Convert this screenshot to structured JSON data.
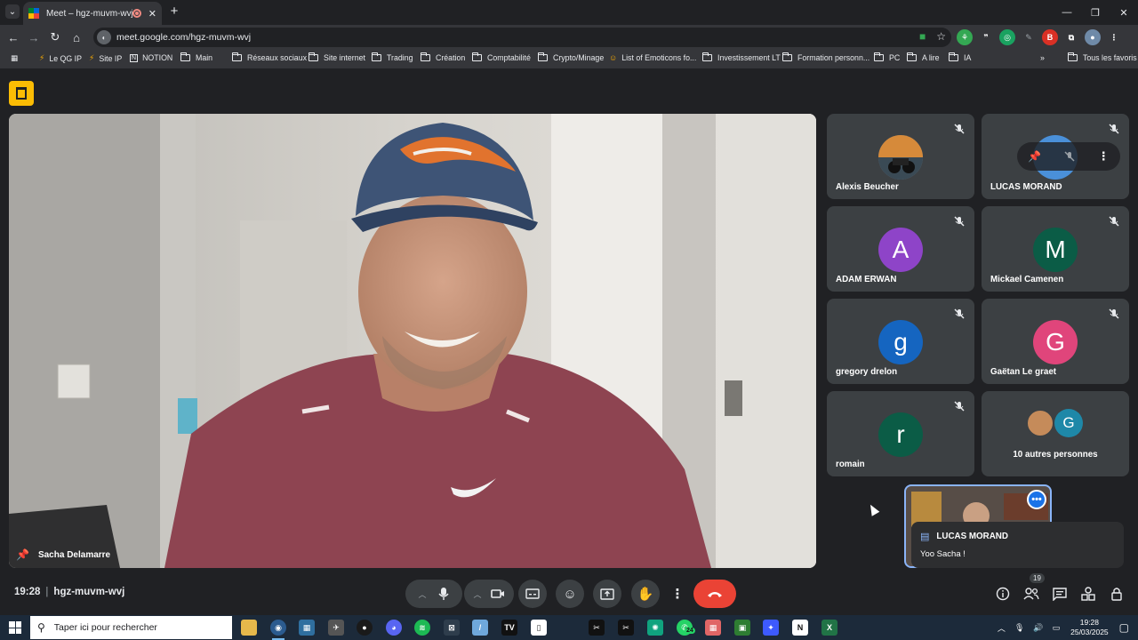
{
  "browser": {
    "tab": {
      "title": "Meet – hgz-muvm-wvj"
    },
    "url": "meet.google.com/hgz-muvm-wvj",
    "bookmarks": [
      {
        "label": "Le QG IP",
        "icon": "lightning-icon",
        "type": "link"
      },
      {
        "label": "Site IP",
        "icon": "lightning-icon",
        "type": "link"
      },
      {
        "label": "NOTION",
        "icon": "notion-icon",
        "type": "link"
      },
      {
        "label": "Main",
        "icon": "folder-icon",
        "type": "folder"
      },
      {
        "label": "Réseaux sociaux",
        "icon": "folder-icon",
        "type": "folder"
      },
      {
        "label": "Site internet",
        "icon": "folder-icon",
        "type": "folder"
      },
      {
        "label": "Trading",
        "icon": "folder-icon",
        "type": "folder"
      },
      {
        "label": "Création",
        "icon": "folder-icon",
        "type": "folder"
      },
      {
        "label": "Comptabilité",
        "icon": "folder-icon",
        "type": "folder"
      },
      {
        "label": "Crypto/Minage",
        "icon": "folder-icon",
        "type": "folder"
      },
      {
        "label": "List of Emoticons fo...",
        "icon": "emoji-icon",
        "type": "link"
      },
      {
        "label": "Investissement LT",
        "icon": "folder-icon",
        "type": "folder"
      },
      {
        "label": "Formation personn...",
        "icon": "folder-icon",
        "type": "folder"
      },
      {
        "label": "PC",
        "icon": "folder-icon",
        "type": "folder"
      },
      {
        "label": "A lire",
        "icon": "folder-icon",
        "type": "folder"
      },
      {
        "label": "IA",
        "icon": "folder-icon",
        "type": "folder"
      }
    ],
    "all_bookmarks": "Tous les favoris"
  },
  "meet": {
    "speaker_name": "Sacha Delamarre",
    "participants": [
      {
        "name": "Alexis Beucher",
        "initial": "",
        "color": "",
        "muted": true
      },
      {
        "name": "LUCAS MORAND",
        "initial": "",
        "color": "#4a90d9",
        "muted": true
      },
      {
        "name": "ADAM ERWAN",
        "initial": "A",
        "color": "#8e44c8",
        "muted": true
      },
      {
        "name": "Mickael Camenen",
        "initial": "M",
        "color": "#0b5c46",
        "muted": true
      },
      {
        "name": "gregory drelon",
        "initial": "g",
        "color": "#1565c0",
        "muted": true
      },
      {
        "name": "Gaëtan Le graet",
        "initial": "G",
        "color": "#e0457b",
        "muted": true
      },
      {
        "name": "romain",
        "initial": "r",
        "color": "#0b5c46",
        "muted": true
      }
    ],
    "others": {
      "label": "10 autres personnes",
      "initial": "G",
      "color": "#1e88a8"
    },
    "chat": {
      "sender": "LUCAS MORAND",
      "message": "Yoo Sacha !"
    },
    "time": "19:28",
    "meeting_code": "hgz-muvm-wvj",
    "people_count": "19"
  },
  "taskbar": {
    "search_placeholder": "Taper ici pour rechercher",
    "time": "19:28",
    "date": "25/03/2025",
    "whatsapp_badge": "24"
  }
}
